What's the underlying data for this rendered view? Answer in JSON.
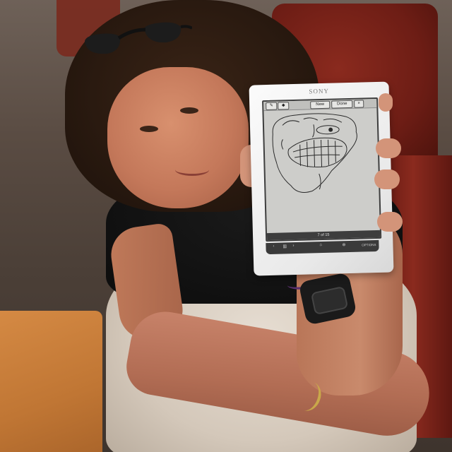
{
  "photo": {
    "description_hidden": "",
    "colors": {
      "chair": "#7a2418",
      "shirt": "#101010",
      "pants": "#ddd2c5",
      "skin": "#c4785a",
      "hair": "#2a1a10",
      "table": "#c9803c",
      "reader_body": "#f2f2f2",
      "reader_screen": "#cdcdca"
    }
  },
  "ereader": {
    "brand": "SONY",
    "toolbar": {
      "new_label": "New",
      "done_label": "Done",
      "close_label": "×"
    },
    "page_indicator": "7 of 15",
    "options_label": "OPTIONS"
  }
}
